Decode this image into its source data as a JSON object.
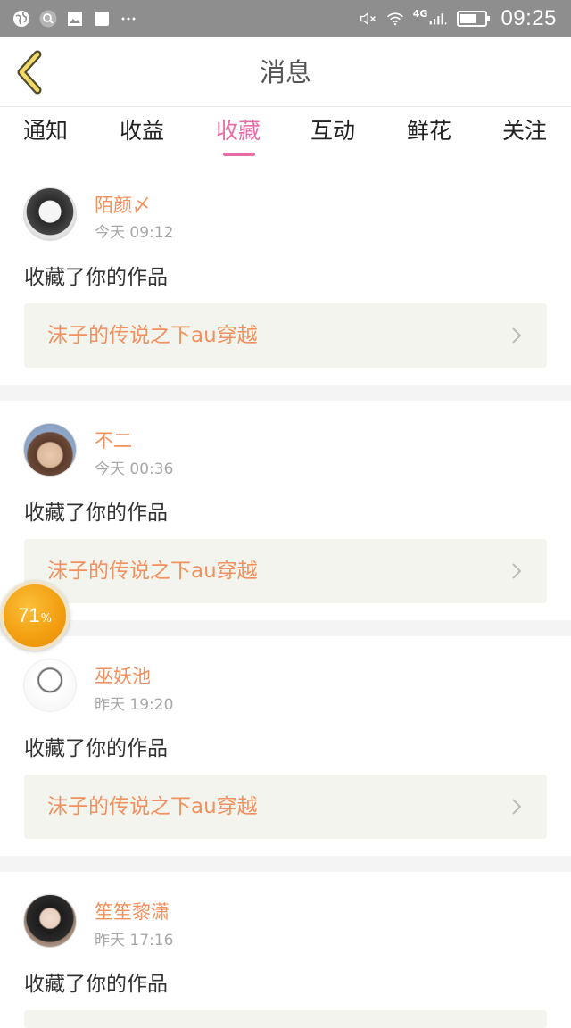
{
  "status_bar": {
    "time": "09:25",
    "network": "4G",
    "left_icons": [
      "globe-icon",
      "search-icon",
      "image-icon",
      "square-icon",
      "more-icon"
    ],
    "right_icons": [
      "mute-icon",
      "wifi-icon",
      "signal-icon",
      "battery-icon"
    ]
  },
  "header": {
    "title": "消息"
  },
  "tabs": [
    {
      "label": "通知"
    },
    {
      "label": "收益"
    },
    {
      "label": "收藏",
      "active": true
    },
    {
      "label": "互动"
    },
    {
      "label": "鲜花"
    },
    {
      "label": "关注"
    }
  ],
  "messages": [
    {
      "user": "陌颜〆",
      "time": "今天 09:12",
      "action": "收藏了你的作品",
      "work": "沫子的传说之下au穿越"
    },
    {
      "user": "不二",
      "time": "今天 00:36",
      "action": "收藏了你的作品",
      "work": "沫子的传说之下au穿越"
    },
    {
      "user": "巫妖池",
      "time": "昨天 19:20",
      "action": "收藏了你的作品",
      "work": "沫子的传说之下au穿越"
    },
    {
      "user": "笙笙黎潇",
      "time": "昨天 17:16",
      "action": "收藏了你的作品",
      "work": ""
    }
  ],
  "floating_badge": {
    "value": "71",
    "unit": "%"
  },
  "colors": {
    "accent": "#e96da4",
    "name": "#f0915f",
    "status_bar": "#8e8e8e"
  }
}
